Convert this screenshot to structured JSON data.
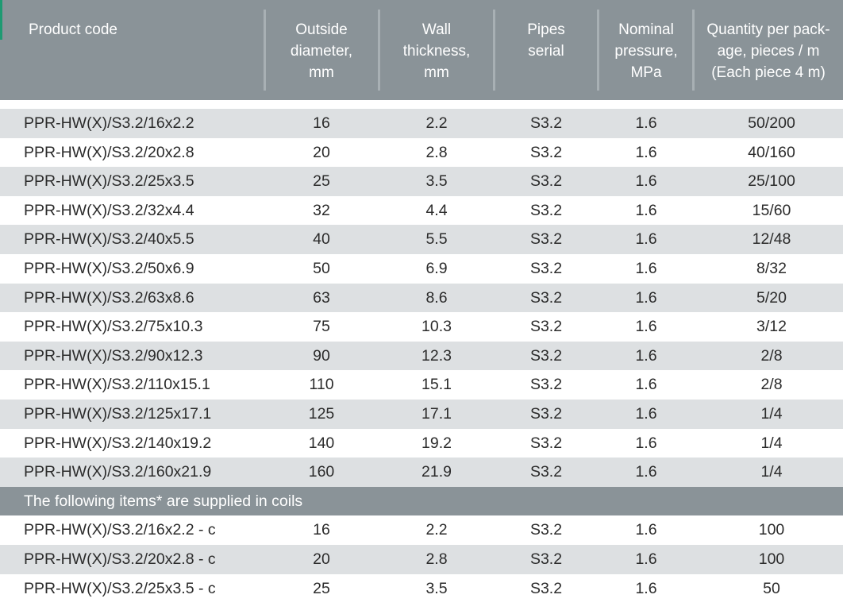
{
  "colors": {
    "header_bg": "#8a9398",
    "row_shade": "#dde0e2",
    "accent": "#1e9a72"
  },
  "header": {
    "product_code": "Product code",
    "outside_diameter": "Outside\ndiameter,\nmm",
    "wall_thickness": "Wall\nthickness,\nmm",
    "pipes_serial": "Pipes\nserial",
    "nominal_pressure": "Nominal\npressure,\nMPa",
    "quantity": "Quantity per pack-\nage, pieces / m\n(Each piece 4 m)"
  },
  "rows": [
    [
      "PPR-HW(X)/S3.2/16x2.2",
      "16",
      "2.2",
      "S3.2",
      "1.6",
      "50/200"
    ],
    [
      "PPR-HW(X)/S3.2/20x2.8",
      "20",
      "2.8",
      "S3.2",
      "1.6",
      "40/160"
    ],
    [
      "PPR-HW(X)/S3.2/25x3.5",
      "25",
      "3.5",
      "S3.2",
      "1.6",
      "25/100"
    ],
    [
      "PPR-HW(X)/S3.2/32x4.4",
      "32",
      "4.4",
      "S3.2",
      "1.6",
      "15/60"
    ],
    [
      "PPR-HW(X)/S3.2/40x5.5",
      "40",
      "5.5",
      "S3.2",
      "1.6",
      "12/48"
    ],
    [
      "PPR-HW(X)/S3.2/50x6.9",
      "50",
      "6.9",
      "S3.2",
      "1.6",
      "8/32"
    ],
    [
      "PPR-HW(X)/S3.2/63x8.6",
      "63",
      "8.6",
      "S3.2",
      "1.6",
      "5/20"
    ],
    [
      "PPR-HW(X)/S3.2/75x10.3",
      "75",
      "10.3",
      "S3.2",
      "1.6",
      "3/12"
    ],
    [
      "PPR-HW(X)/S3.2/90x12.3",
      "90",
      "12.3",
      "S3.2",
      "1.6",
      "2/8"
    ],
    [
      "PPR-HW(X)/S3.2/110x15.1",
      "110",
      "15.1",
      "S3.2",
      "1.6",
      "2/8"
    ],
    [
      "PPR-HW(X)/S3.2/125x17.1",
      "125",
      "17.1",
      "S3.2",
      "1.6",
      "1/4"
    ],
    [
      "PPR-HW(X)/S3.2/140x19.2",
      "140",
      "19.2",
      "S3.2",
      "1.6",
      "1/4"
    ],
    [
      "PPR-HW(X)/S3.2/160x21.9",
      "160",
      "21.9",
      "S3.2",
      "1.6",
      "1/4"
    ]
  ],
  "coils_label": "The following items* are supplied in coils",
  "coil_rows": [
    [
      "PPR-HW(X)/S3.2/16x2.2 - c",
      "16",
      "2.2",
      "S3.2",
      "1.6",
      "100"
    ],
    [
      "PPR-HW(X)/S3.2/20x2.8 - c",
      "20",
      "2.8",
      "S3.2",
      "1.6",
      "100"
    ],
    [
      "PPR-HW(X)/S3.2/25x3.5 - c",
      "25",
      "3.5",
      "S3.2",
      "1.6",
      "50"
    ]
  ]
}
